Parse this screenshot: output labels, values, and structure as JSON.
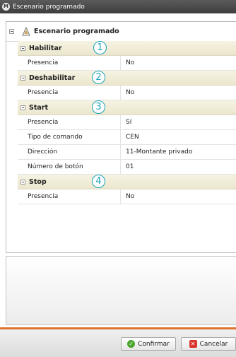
{
  "window": {
    "title": "Escenario programado"
  },
  "tree": {
    "root_label": "Escenario programado",
    "groups": [
      {
        "name": "Habilitar",
        "callout": "1",
        "props": [
          {
            "name": "Presencia",
            "value": "No"
          }
        ]
      },
      {
        "name": "Deshabilitar",
        "callout": "2",
        "props": [
          {
            "name": "Presencia",
            "value": "No"
          }
        ]
      },
      {
        "name": "Start",
        "callout": "3",
        "props": [
          {
            "name": "Presencia",
            "value": "Sí"
          },
          {
            "name": "Tipo de comando",
            "value": "CEN"
          },
          {
            "name": "Dirección",
            "value": "11-Montante privado"
          },
          {
            "name": "Número de botón",
            "value": "01"
          }
        ]
      },
      {
        "name": "Stop",
        "callout": "4",
        "props": [
          {
            "name": "Presencia",
            "value": "No"
          }
        ]
      }
    ]
  },
  "buttons": {
    "confirm": "Confirmar",
    "cancel": "Cancelar"
  },
  "colors": {
    "accent_orange": "#e0742c",
    "callout": "#1aa3b8",
    "group_bg": "#f1edd8"
  },
  "icons": {
    "app": "app-icon",
    "root": "scenario-icon",
    "confirm": "checkmark-icon",
    "cancel": "close-icon"
  }
}
